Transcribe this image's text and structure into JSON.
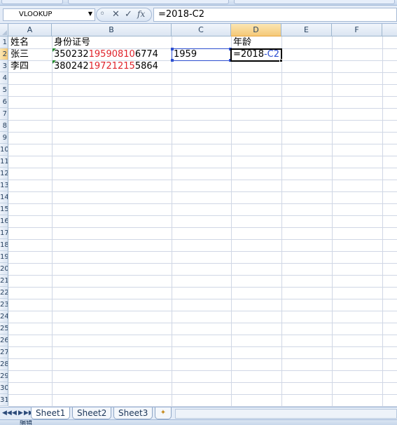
{
  "formula_bar": {
    "name_box": "VLOOKUP",
    "formula": "=2018-C2",
    "cancel_icon": "✕",
    "enter_icon": "✓",
    "fx_label": "fx"
  },
  "columns": [
    "A",
    "B",
    "C",
    "D",
    "E",
    "F"
  ],
  "row_numbers": [
    "1",
    "2",
    "3",
    "4",
    "5",
    "6",
    "7",
    "8",
    "9",
    "10",
    "11",
    "12",
    "13",
    "14",
    "15",
    "16",
    "17",
    "18",
    "19",
    "20",
    "21",
    "22",
    "23",
    "24",
    "25",
    "26",
    "27",
    "28",
    "29",
    "30",
    "31"
  ],
  "cells": {
    "A1": "姓名",
    "B1": "身份证号",
    "D1": "年龄",
    "A2": "张三",
    "B2_prefix": "350232",
    "B2_mid": "19590810",
    "B2_suffix": "6774",
    "C2": "1959",
    "D2_prefix": "=2018",
    "D2_ref": "-C2",
    "A3": "李四",
    "B3_prefix": "380242",
    "B3_mid": "19721215",
    "B3_suffix": "5864"
  },
  "sheets": [
    "Sheet1",
    "Sheet2",
    "Sheet3"
  ],
  "active_sheet": "Sheet1",
  "status": "编辑",
  "colors": {
    "accent_red": "#e0242b",
    "reference_blue": "#2d4fd0",
    "header_active": "#f5c978"
  }
}
